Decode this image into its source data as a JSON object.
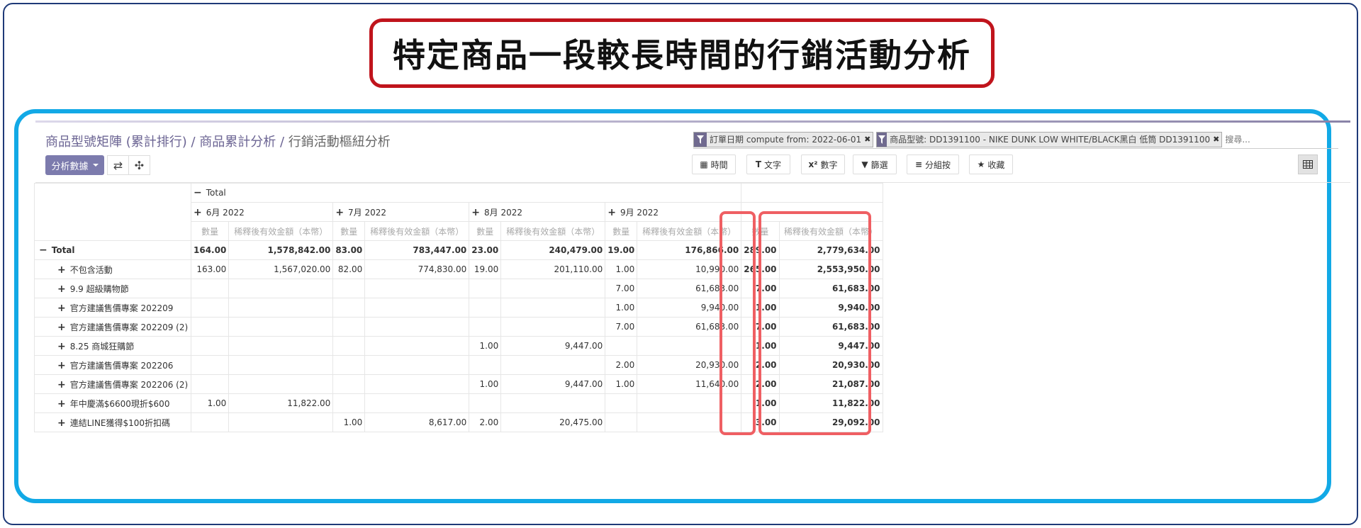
{
  "slide": {
    "title": "特定商品一段較長時間的行銷活動分析"
  },
  "breadcrumb": {
    "part1": "商品型號矩陣 (累計排行)",
    "sep": " / ",
    "part2": "商品累計分析",
    "part3": "行銷活動樞紐分析"
  },
  "search": {
    "facets": [
      {
        "label": "訂單日期 compute from: 2022-06-01"
      },
      {
        "label": "商品型號: DD1391100 - NIKE DUNK LOW WHITE/BLACK黑白 低筒 DD1391100"
      }
    ],
    "placeholder": "搜尋..."
  },
  "toolbar": {
    "measures_label": "分析數據",
    "swap_icon": "⇄",
    "expand_icon": "✣",
    "buttons": [
      {
        "icon": "▦",
        "label": "時間"
      },
      {
        "icon": "T",
        "label": "文字"
      },
      {
        "icon": "x²",
        "label": "數字"
      },
      {
        "icon": "▼",
        "label": "篩選"
      },
      {
        "icon": "≡",
        "label": "分組按"
      },
      {
        "icon": "★",
        "label": "收藏"
      }
    ]
  },
  "pivot": {
    "col_total_label": "Total",
    "months": [
      "6月 2022",
      "7月 2022",
      "8月 2022",
      "9月 2022"
    ],
    "measure_qty": "數量",
    "measure_amt": "稀釋後有效金額（本幣）",
    "rows": [
      {
        "label": "Total",
        "sign": "−",
        "bold": true,
        "cells": [
          "164.00",
          "1,578,842.00",
          "83.00",
          "783,447.00",
          "23.00",
          "240,479.00",
          "19.00",
          "176,866.00"
        ],
        "total_qty": "289.00",
        "total_amt": "2,779,634.00"
      },
      {
        "label": "不包含活動",
        "sign": "+",
        "bold": false,
        "cells": [
          "163.00",
          "1,567,020.00",
          "82.00",
          "774,830.00",
          "19.00",
          "201,110.00",
          "1.00",
          "10,990.00"
        ],
        "total_qty": "265.00",
        "total_amt": "2,553,950.00"
      },
      {
        "label": "9.9 超級購物節",
        "sign": "+",
        "bold": false,
        "cells": [
          "",
          "",
          "",
          "",
          "",
          "",
          "7.00",
          "61,683.00"
        ],
        "total_qty": "7.00",
        "total_amt": "61,683.00"
      },
      {
        "label": "官方建議售價專案 202209",
        "sign": "+",
        "bold": false,
        "cells": [
          "",
          "",
          "",
          "",
          "",
          "",
          "1.00",
          "9,940.00"
        ],
        "total_qty": "1.00",
        "total_amt": "9,940.00"
      },
      {
        "label": "官方建議售價專案 202209 (2)",
        "sign": "+",
        "bold": false,
        "cells": [
          "",
          "",
          "",
          "",
          "",
          "",
          "7.00",
          "61,683.00"
        ],
        "total_qty": "7.00",
        "total_amt": "61,683.00"
      },
      {
        "label": "8.25 商城狂購節",
        "sign": "+",
        "bold": false,
        "cells": [
          "",
          "",
          "",
          "",
          "1.00",
          "9,447.00",
          "",
          ""
        ],
        "total_qty": "1.00",
        "total_amt": "9,447.00"
      },
      {
        "label": "官方建議售價專案 202206",
        "sign": "+",
        "bold": false,
        "cells": [
          "",
          "",
          "",
          "",
          "",
          "",
          "2.00",
          "20,930.00"
        ],
        "total_qty": "2.00",
        "total_amt": "20,930.00"
      },
      {
        "label": "官方建議售價專案 202206 (2)",
        "sign": "+",
        "bold": false,
        "cells": [
          "",
          "",
          "",
          "",
          "1.00",
          "9,447.00",
          "1.00",
          "11,640.00"
        ],
        "total_qty": "2.00",
        "total_amt": "21,087.00"
      },
      {
        "label": "年中慶滿$6600現折$600",
        "sign": "+",
        "bold": false,
        "cells": [
          "1.00",
          "11,822.00",
          "",
          "",
          "",
          "",
          "",
          ""
        ],
        "total_qty": "1.00",
        "total_amt": "11,822.00"
      },
      {
        "label": "連結LINE獲得$100折扣碼",
        "sign": "+",
        "bold": false,
        "cells": [
          "",
          "",
          "1.00",
          "8,617.00",
          "2.00",
          "20,475.00",
          "",
          ""
        ],
        "total_qty": "3.00",
        "total_amt": "29,092.00"
      }
    ]
  },
  "colors": {
    "accent": "#7c7bad",
    "highlight": "#ef5f63",
    "frame": "#12a9e6",
    "title_border": "#c0141c"
  }
}
